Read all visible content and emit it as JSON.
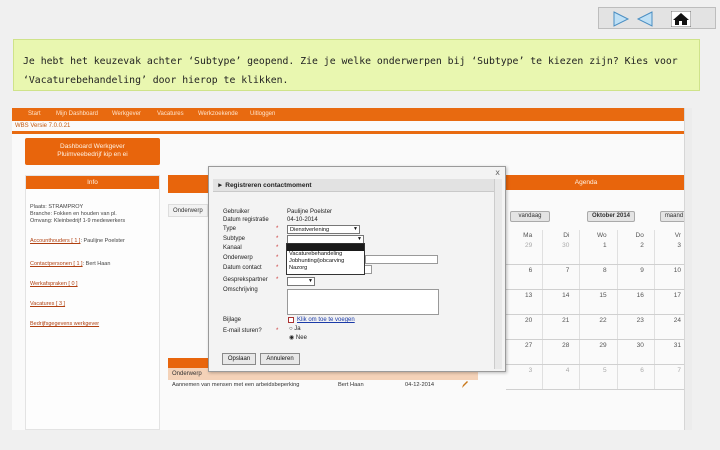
{
  "nav": {
    "next_icon": "play-forward-icon",
    "prev_icon": "play-back-icon",
    "home_icon": "home-icon"
  },
  "instruction": {
    "line1": "Je hebt het keuzevak achter ‘Subtype’ geopend. Zie je welke onderwerpen bij ‘Subtype’ te kiezen zijn? Kies voor",
    "line2": "‘Vacaturebehandeling’ door hierop te klikken."
  },
  "app": {
    "menu": [
      "Start",
      "Mijn Dashboard",
      "Werkgever",
      "Vacatures",
      "Werkzoekende",
      "Uitloggen"
    ],
    "version": "WBS Versie 7.0.0.21",
    "dashboard_title_1": "Dashboard Werkgever",
    "dashboard_title_2": "Pluimveebedrijf kip en ei",
    "info": {
      "header": "Info",
      "plaats": "Plaats: STRAMPROY",
      "branche": "Branche: Fokken en houden van pl.",
      "omvang": "Omvang: Kleinbedrijf 1-9 medewerkers",
      "accounthouders": "Accounthouders [ 1 ]",
      "accounthouder_name": ": Paulijne Poelster",
      "contactpersonen": "Contactpersonen [ 1 ]",
      "contactpersoon_name": ": Bert Haan",
      "werkafspraken": "Werkafspraken [ 0 ]",
      "vacatures": "Vacatures [ 3 ]",
      "bedrijfsgegevens": "Bedrijfsgegevens werkgever"
    },
    "mid_tab": "Onderwerp",
    "bottom": {
      "col1": "Onderwerp",
      "row_subject": "Aannemen van mensen met een arbeidsbeperking",
      "row_person": "Bert Haan",
      "row_date": "04-12-2014"
    },
    "agenda": {
      "header": "Agenda",
      "prev_btn": "vandaag",
      "month": "Oktober 2014",
      "view_btn": "maand",
      "days": [
        "Ma",
        "Di",
        "Wo",
        "Do",
        "Vr"
      ],
      "weeks": [
        [
          "29",
          "30",
          "1",
          "2",
          "3"
        ],
        [
          "6",
          "7",
          "8",
          "9",
          "10"
        ],
        [
          "13",
          "14",
          "15",
          "16",
          "17"
        ],
        [
          "20",
          "21",
          "22",
          "23",
          "24"
        ],
        [
          "27",
          "28",
          "29",
          "30",
          "31"
        ],
        [
          "3",
          "4",
          "5",
          "6",
          "7"
        ]
      ]
    }
  },
  "modal": {
    "title": "Registreren contactmoment",
    "close": "x",
    "fields": {
      "gebruiker_label": "Gebruiker",
      "gebruiker_value": "Paulijne Poelster",
      "datum_label": "Datum registratie",
      "datum_value": "04-10-2014",
      "type_label": "Type",
      "type_value": "Dienstverlening",
      "subtype_label": "Subtype",
      "subtype_value": "",
      "kanaal_label": "Kanaal",
      "onderwerp_label": "Onderwerp",
      "datum_contact_label": "Datum contact",
      "gesprekspartner_label": "Gesprekspartner",
      "omschrijving_label": "Omschrijving",
      "bijlage_label": "Bijlage",
      "bijlage_link": "Klik om toe te voegen",
      "email_label": "E-mail sturen?",
      "radio_ja": "Ja",
      "radio_nee": "Nee"
    },
    "dropdown_options": [
      "",
      "Vacaturebehandeling",
      "Jobhunting/jobcarving",
      "Nazorg"
    ],
    "opslaan": "Opslaan",
    "annuleren": "Annuleren"
  }
}
